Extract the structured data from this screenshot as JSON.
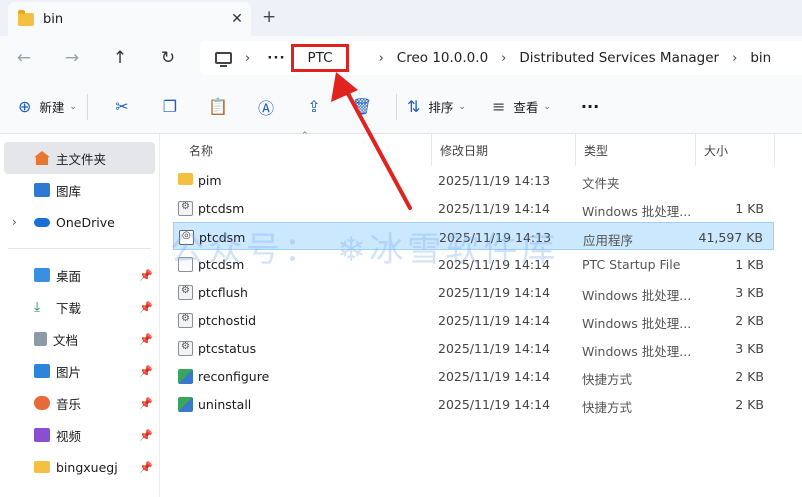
{
  "window": {
    "tab_title": "bin",
    "close_glyph": "✕",
    "new_tab_glyph": "+"
  },
  "nav": {
    "back": "←",
    "forward": "→",
    "up": "↑",
    "refresh": "↻",
    "more_glyph": "···"
  },
  "breadcrumb": [
    "PTC",
    "Creo 10.0.0.0",
    "Distributed Services Manager",
    "bin"
  ],
  "toolbar": {
    "new_label": "新建",
    "sort_label": "排序",
    "view_label": "查看",
    "more_glyph": "···"
  },
  "sidebar": {
    "home": "主文件夹",
    "gallery": "图库",
    "onedrive": "OneDrive",
    "quick": [
      "桌面",
      "下载",
      "文档",
      "图片",
      "音乐",
      "视频",
      "bingxuegj"
    ]
  },
  "columns": {
    "name": "名称",
    "date": "修改日期",
    "type": "类型",
    "size": "大小"
  },
  "files": [
    {
      "name": "pim",
      "date": "2025/11/19 14:13",
      "type": "文件夹",
      "size": "",
      "icon": "folder-icon"
    },
    {
      "name": "ptcdsm",
      "date": "2025/11/19 14:14",
      "type": "Windows 批处理...",
      "size": "1 KB",
      "icon": "batch-file-icon"
    },
    {
      "name": "ptcdsm",
      "date": "2025/11/19 14:13",
      "type": "应用程序",
      "size": "41,597 KB",
      "icon": "application-icon"
    },
    {
      "name": "ptcdsm",
      "date": "2025/11/19 14:14",
      "type": "PTC Startup File",
      "size": "1 KB",
      "icon": "file-icon"
    },
    {
      "name": "ptcflush",
      "date": "2025/11/19 14:14",
      "type": "Windows 批处理...",
      "size": "3 KB",
      "icon": "batch-file-icon"
    },
    {
      "name": "ptchostid",
      "date": "2025/11/19 14:14",
      "type": "Windows 批处理...",
      "size": "2 KB",
      "icon": "batch-file-icon"
    },
    {
      "name": "ptcstatus",
      "date": "2025/11/19 14:14",
      "type": "Windows 批处理...",
      "size": "3 KB",
      "icon": "batch-file-icon"
    },
    {
      "name": "reconfigure",
      "date": "2025/11/19 14:14",
      "type": "快捷方式",
      "size": "2 KB",
      "icon": "shortcut-icon"
    },
    {
      "name": "uninstall",
      "date": "2025/11/19 14:14",
      "type": "快捷方式",
      "size": "2 KB",
      "icon": "shortcut-icon"
    }
  ],
  "watermark": "公众号：  ❄冰雪软件库",
  "colors": {
    "highlight_red": "#e0231f",
    "selection": "#cce8ff",
    "accent": "#1f5fbf"
  }
}
